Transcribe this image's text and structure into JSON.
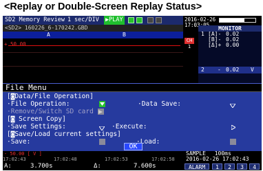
{
  "caption": "<Replay or Double-Screen Replay Status>",
  "topbar": {
    "title": "SD2 Memory Review",
    "page": "1",
    "timebase": "sec/DIV",
    "play": "▶PLAY",
    "file": "<SD2> 160226_6-170242.GBD"
  },
  "clock": {
    "date": "2016-02-26",
    "time": "17:03:05"
  },
  "battery_level": 0.7,
  "channel_header": {
    "a": "A",
    "b": "B"
  },
  "wave": {
    "tag": "+ 50.00",
    "ch_label": "CH 1"
  },
  "monitor": {
    "title": "MONITOR",
    "rows": [
      {
        "n": "1",
        "id": "[A]-",
        "v": "0.02"
      },
      {
        "n": "",
        "id": "[B]-",
        "v": "0.02"
      },
      {
        "n": "",
        "id": "[Δ]+",
        "v": "0.00"
      },
      {
        "n": "2",
        "id": "-",
        "v": "0.02",
        "unit": "V"
      }
    ]
  },
  "menu": {
    "title": "File Menu",
    "data_section": "[◙Data/File Operation]",
    "file_operation_label": "·File Operation:",
    "data_save_label": "·Data Save:",
    "remove_sd_label": "·Remove/Switch SD card 2",
    "screen_copy_section": "[◙ Screen Copy]",
    "save_settings_label": "·Save Settings:",
    "execute_label": "·Execute:",
    "save_load_section": "[◙Save/Load current settings]",
    "save_label": "·Save:",
    "load_label": "·Load:",
    "ok_label": "OK"
  },
  "bottom": {
    "scale": "- 50.00 [ V ]",
    "ticks": [
      "17:02:43",
      "17:02:48",
      "17:02:53",
      "17:02:58"
    ],
    "cursor_a_label": "A:",
    "cursor_a_value": "3.700s",
    "cursor_delta_label": "Δ:",
    "cursor_delta_value": "7.600s",
    "sample_label": "SAMPLE",
    "sample_value": "100ms",
    "sample_datetime": "2016-02-26 17:02:43",
    "alarm_label": "ALARM",
    "alarm_buttons": [
      "1",
      "2",
      "3",
      "4"
    ]
  },
  "colors": {
    "menu_bg": "#263a9e",
    "topbar_bg": "#1c2a6c",
    "play_green": "#1fbf2e",
    "trace_red": "#e01010",
    "ok_blue": "#2a49ff"
  }
}
